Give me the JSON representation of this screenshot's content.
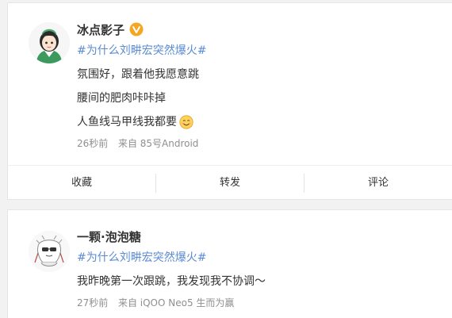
{
  "posts": [
    {
      "username": "冰点影子",
      "verified": true,
      "hashtag": "#为什么刘畊宏突然爆火#",
      "lines": [
        "氛围好，跟着他我愿意跳",
        "腰间的肥肉咔咔掉",
        "人鱼线马甲线我都要"
      ],
      "time": "26秒前",
      "source": "来自 85号Android",
      "actions": [
        "收藏",
        "转发",
        "评论"
      ]
    },
    {
      "username": "一颗·泡泡糖",
      "hashtag": "#为什么刘畊宏突然爆火#",
      "lines": [
        "我昨晚第一次跟跳，我发现我不协调～"
      ],
      "time": "27秒前",
      "source": "来自 iQOO Neo5 生而为赢"
    }
  ],
  "colors": {
    "hashtag": "#5a8bd3",
    "verified_badge": "#f5a623",
    "meta_text": "#8f8f8f",
    "page_background": "#f2f2f2"
  },
  "icons": {
    "verified": "verified-badge-icon",
    "emoji": "smile-emoji-icon"
  }
}
